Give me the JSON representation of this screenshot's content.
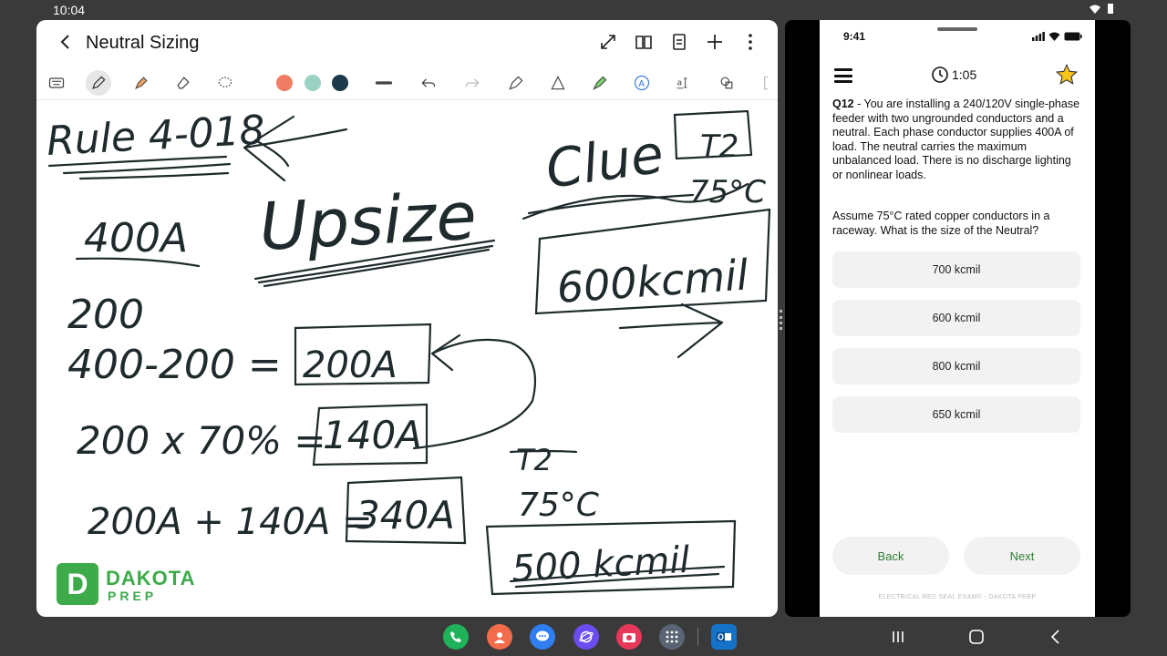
{
  "status_bar": {
    "time": "10:04"
  },
  "notes_app": {
    "title": "Neutral Sizing",
    "pen_colors": [
      "#f07c63",
      "#9ad2c3",
      "#1c3a4a"
    ],
    "handwriting": {
      "rule": "Rule 4-018",
      "upsize": "Upsize",
      "load": "400A",
      "line1": "200",
      "line2": "400-200 =",
      "box1": "200A",
      "line3": "200 x 70% =",
      "box2": "140A",
      "line4": "200A + 140A =",
      "box3": "340A",
      "clue": "Clue",
      "t2_top": "T2",
      "c75_top": "75°C",
      "box_top": "600kcmil",
      "t2_bottom": "T2",
      "c75_bottom": "75°C",
      "box_bottom": "500 kcmil"
    },
    "logo": {
      "word1": "DAKOTA",
      "word2": "PREP",
      "mark": "D"
    }
  },
  "quiz_app": {
    "phone_time": "9:41",
    "timer": "1:05",
    "question_number": "Q12",
    "question_text": " - You are installing a 240/120V single-phase feeder with two ungrounded conductors and a neutral. Each phase conductor supplies 400A of load. The neutral carries the maximum unbalanced load. There is no discharge lighting or nonlinear loads.",
    "assume_text": "Assume 75°C rated copper conductors in a raceway. What is the size of the Neutral?",
    "options": [
      "700 kcmil",
      "600 kcmil",
      "800 kcmil",
      "650 kcmil"
    ],
    "back_label": "Back",
    "next_label": "Next",
    "footer": "ELECTRICAL RED SEAL EXAM© - DAKOTA PREP"
  }
}
